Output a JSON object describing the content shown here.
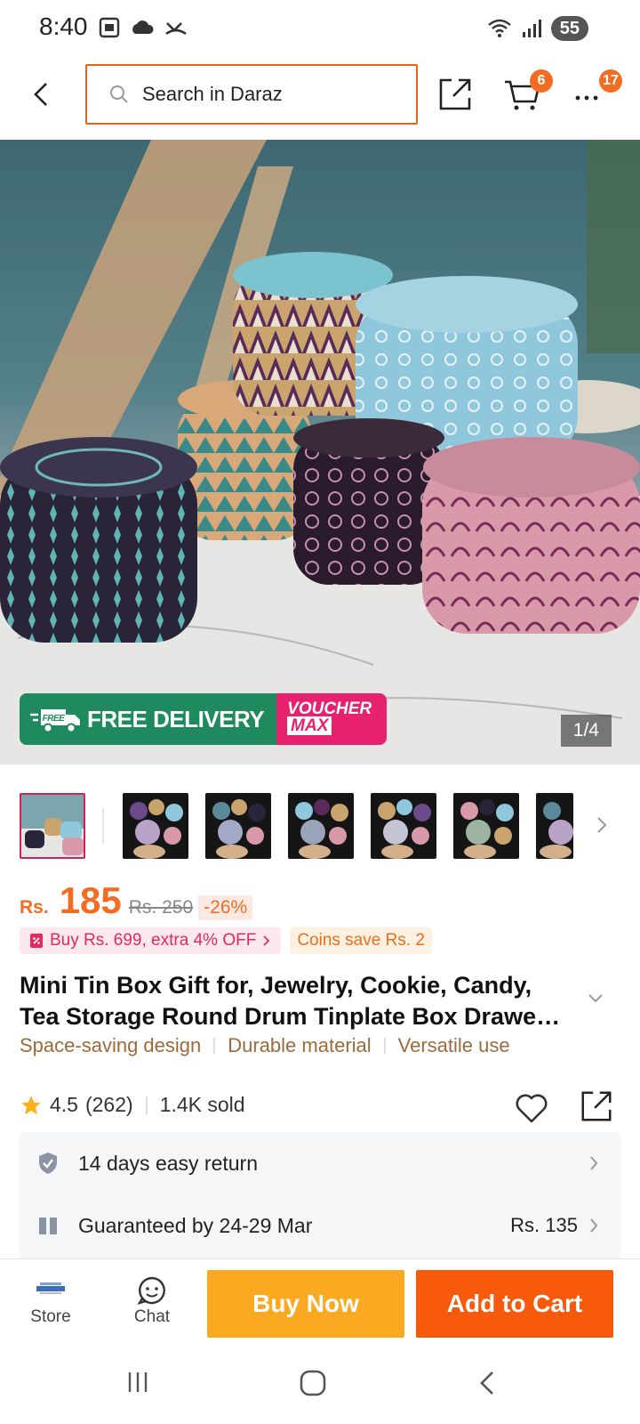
{
  "status_bar": {
    "time": "8:40",
    "battery": "55"
  },
  "header": {
    "search_placeholder": "Search in Daraz",
    "cart_count": "6",
    "more_count": "17"
  },
  "hero": {
    "delivery_label": "FREE DELIVERY",
    "free_tag": "FREE",
    "voucher_line1": "VOUCHER",
    "voucher_line2": "MAX",
    "pager": "1/4"
  },
  "price": {
    "currency": "Rs.",
    "amount": "185",
    "original": "Rs. 250",
    "discount": "-26%"
  },
  "promos": {
    "offer": "Buy Rs. 699, extra 4% OFF",
    "coins": "Coins save Rs. 2"
  },
  "product": {
    "title_line1": "Mini Tin Box Gift for, Jewelry, Cookie, Candy,",
    "title_line2": "Tea Storage Round Drum Tinplate Box Drawe…",
    "features": [
      "Space-saving design",
      "Durable material",
      "Versatile use"
    ],
    "rating": "4.5",
    "reviews": "(262)",
    "sold": "1.4K sold"
  },
  "services": {
    "return": "14 days easy return",
    "delivery": "Guaranteed by 24-29 Mar",
    "delivery_fee": "Rs. 135"
  },
  "bottom_bar": {
    "store": "Store",
    "chat": "Chat",
    "buy_now": "Buy Now",
    "add_to_cart": "Add to Cart"
  },
  "colors": {
    "accent": "#f36c21",
    "buy_now": "#fca922",
    "add_to_cart": "#f85a0c",
    "search_border": "#e0651e"
  }
}
